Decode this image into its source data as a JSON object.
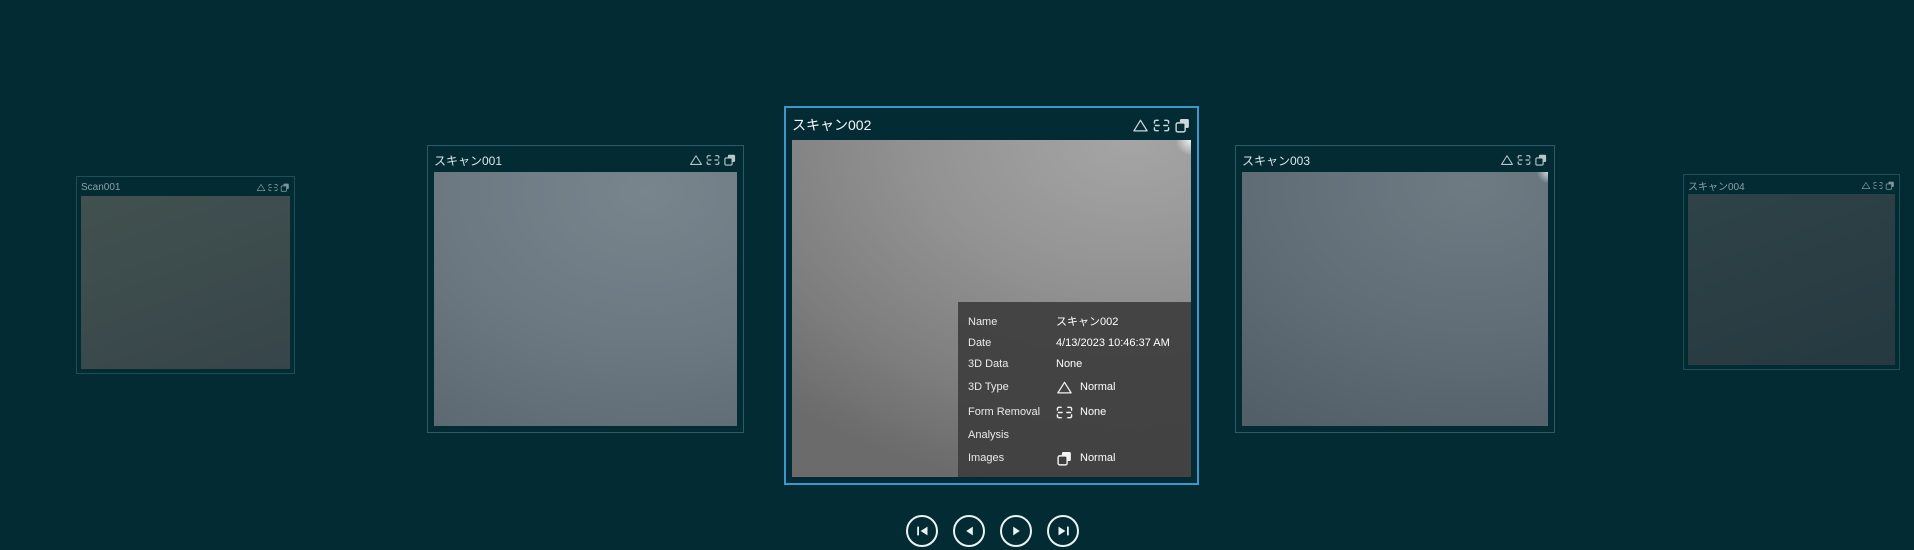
{
  "app": {
    "background_color": "#032b34",
    "accent_color": "#3d97cc",
    "panel_color": "#3e3e3e"
  },
  "carousel": {
    "cards": [
      {
        "title": "Scan001",
        "depth": "far",
        "selected": false,
        "status_icons": [
          "3d-type-icon",
          "form-removal-icon",
          "images-icon"
        ]
      },
      {
        "title": "スキャン001",
        "depth": "near",
        "selected": false,
        "status_icons": [
          "3d-type-icon",
          "form-removal-icon",
          "images-icon"
        ]
      },
      {
        "title": "スキャン002",
        "depth": "center",
        "selected": true,
        "status_icons": [
          "3d-type-icon",
          "form-removal-icon",
          "images-icon"
        ]
      },
      {
        "title": "スキャン003",
        "depth": "near",
        "selected": false,
        "status_icons": [
          "3d-type-icon",
          "form-removal-icon",
          "images-icon"
        ]
      },
      {
        "title": "スキャン004",
        "depth": "far",
        "selected": false,
        "status_icons": [
          "3d-type-icon",
          "form-removal-icon",
          "images-icon"
        ]
      }
    ]
  },
  "info_panel": {
    "rows": [
      {
        "label": "Name",
        "value": "スキャン002",
        "icon": null
      },
      {
        "label": "Date",
        "value": "4/13/2023 10:46:37 AM",
        "icon": null
      },
      {
        "label": "3D Data",
        "value": "None",
        "icon": null
      },
      {
        "label": "3D Type",
        "value": "Normal",
        "icon": "triangle-icon"
      },
      {
        "label": "Form Removal",
        "value": "None",
        "icon": "form-removal-icon"
      },
      {
        "label": "Analysis",
        "value": "",
        "icon": null
      },
      {
        "label": "Images",
        "value": "Normal",
        "icon": "images-icon"
      }
    ]
  },
  "navigation": {
    "buttons": [
      {
        "name": "first"
      },
      {
        "name": "previous"
      },
      {
        "name": "next"
      },
      {
        "name": "last"
      }
    ]
  }
}
